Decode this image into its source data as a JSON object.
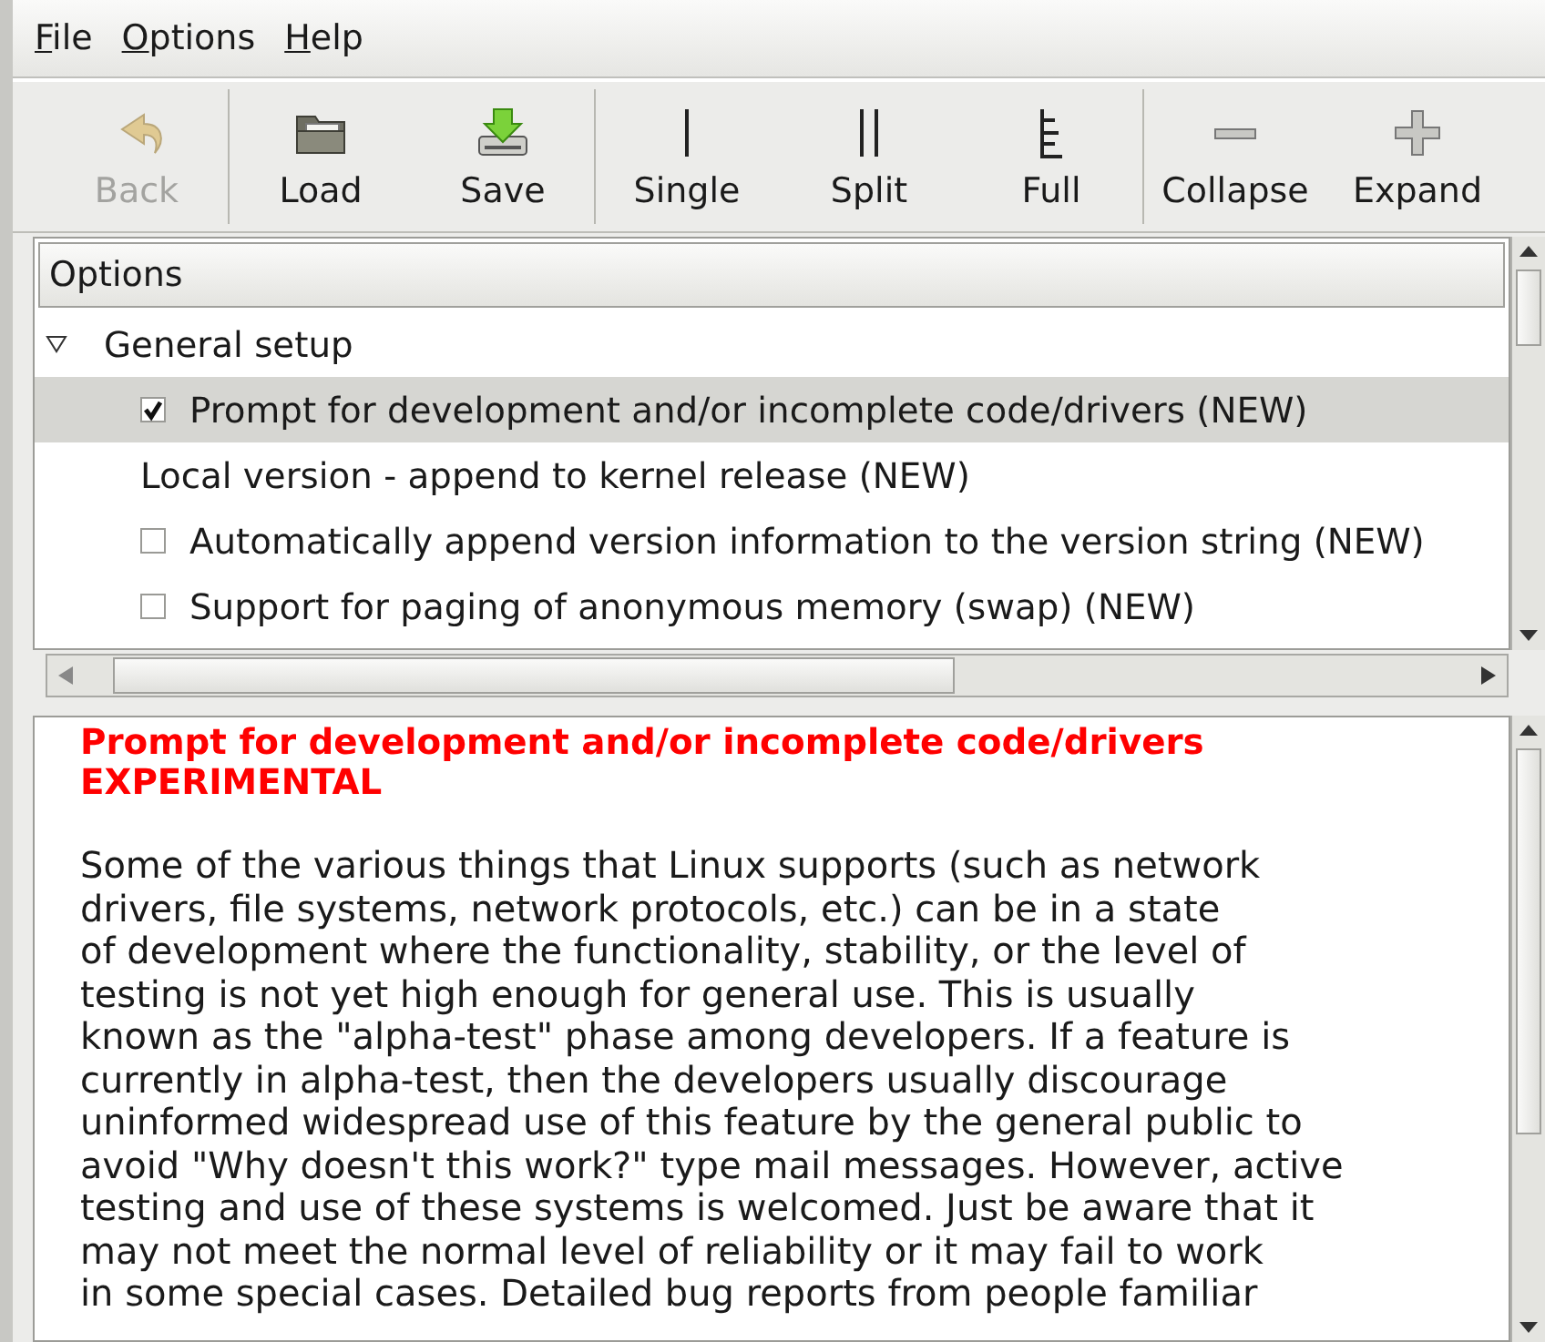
{
  "menu": [
    {
      "label": "File"
    },
    {
      "label": "Options"
    },
    {
      "label": "Help"
    }
  ],
  "toolbar": [
    {
      "label": "Back",
      "kind": "back",
      "disabled": true
    },
    {
      "label": "Load",
      "kind": "load",
      "disabled": false
    },
    {
      "label": "Save",
      "kind": "save",
      "disabled": false
    },
    {
      "label": "Single",
      "kind": "single",
      "disabled": false
    },
    {
      "label": "Split",
      "kind": "split",
      "disabled": false
    },
    {
      "label": "Full",
      "kind": "full",
      "disabled": false
    },
    {
      "label": "Collapse",
      "kind": "collapse",
      "disabled": false
    },
    {
      "label": "Expand",
      "kind": "expand",
      "disabled": false
    }
  ],
  "tree": {
    "column": "Options",
    "items": [
      {
        "label": "General setup",
        "expanded": true,
        "children": [
          {
            "label": "Prompt for development and/or incomplete code/drivers (NEW)",
            "kind": "checkbox",
            "checked": true,
            "selected": true
          },
          {
            "label": "Local version - append to kernel release (NEW)",
            "kind": "text",
            "selected": false
          },
          {
            "label": "Automatically append version information to the version string (NEW)",
            "kind": "checkbox",
            "checked": false,
            "selected": false
          },
          {
            "label": "Support for paging of anonymous memory (swap) (NEW)",
            "kind": "checkbox",
            "checked": false,
            "selected": false
          }
        ]
      }
    ]
  },
  "help": {
    "title": "Prompt for development and/or incomplete code/drivers\nEXPERIMENTAL",
    "body": "Some of the various things that Linux supports (such as network\ndrivers, file systems, network protocols, etc.) can be in a state\nof development where the functionality, stability, or the level of\ntesting is not yet high enough for general use. This is usually\nknown as the \"alpha-test\" phase among developers. If a feature is\ncurrently in alpha-test, then the developers usually discourage\nuninformed widespread use of this feature by the general public to\navoid \"Why doesn't this work?\" type mail messages. However, active\ntesting and use of these systems is welcomed. Just be aware that it\nmay not meet the normal level of reliability or it may fail to work\nin some special cases. Detailed bug reports from people familiar"
  }
}
